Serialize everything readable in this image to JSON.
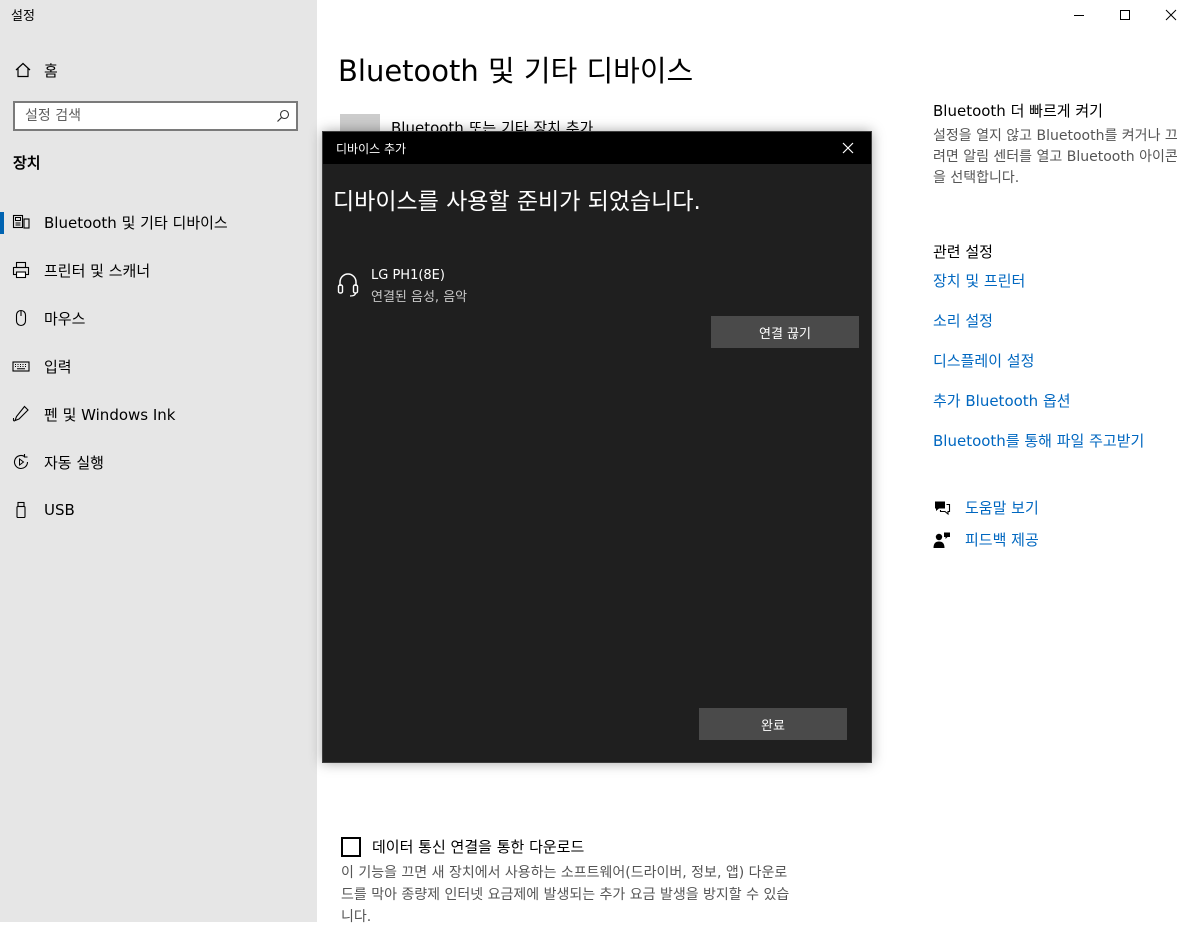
{
  "app": {
    "title": "설정"
  },
  "window_controls": {
    "minimize": "minimize-icon",
    "maximize": "maximize-icon",
    "close": "close-icon"
  },
  "sidebar": {
    "home_label": "홈",
    "search": {
      "placeholder": "설정 검색",
      "value": ""
    },
    "section_title": "장치",
    "items": [
      {
        "label": "Bluetooth 및 기타 디바이스",
        "icon": "bluetooth-device-icon",
        "selected": true
      },
      {
        "label": "프린터 및 스캐너",
        "icon": "printer-icon",
        "selected": false
      },
      {
        "label": "마우스",
        "icon": "mouse-icon",
        "selected": false
      },
      {
        "label": "입력",
        "icon": "keyboard-icon",
        "selected": false
      },
      {
        "label": "펜 및 Windows Ink",
        "icon": "pen-icon",
        "selected": false
      },
      {
        "label": "자동 실행",
        "icon": "autoplay-icon",
        "selected": false
      },
      {
        "label": "USB",
        "icon": "usb-icon",
        "selected": false
      }
    ]
  },
  "main": {
    "title": "Bluetooth 및 기타 디바이스",
    "add_device_label": "Bluetooth 또는 기타 장치 추가",
    "metered": {
      "checkbox_label": "데이터 통신 연결을 통한 다운로드",
      "checked": false,
      "description": "이 기능을 끄면 새 장치에서 사용하는 소프트웨어(드라이버, 정보, 앱) 다운로드를 막아 종량제 인터넷 요금제에 발생되는 추가 요금 발생을 방지할 수 있습니다."
    }
  },
  "right_panel": {
    "quick_heading": "Bluetooth 더 빠르게 켜기",
    "quick_text": "설정을 열지 않고 Bluetooth를 켜거나 끄려면 알림 센터를 열고 Bluetooth 아이콘을 선택합니다.",
    "related_heading": "관련 설정",
    "links": [
      "장치 및 프린터",
      "소리 설정",
      "디스플레이 설정",
      "추가 Bluetooth 옵션",
      "Bluetooth를 통해 파일 주고받기"
    ],
    "help_label": "도움말 보기",
    "feedback_label": "피드백 제공"
  },
  "dialog": {
    "title": "디바이스 추가",
    "heading": "디바이스를 사용할 준비가 되었습니다.",
    "device": {
      "name": "LG PH1(8E)",
      "status": "연결된 음성, 음악",
      "icon": "headphones-icon"
    },
    "disconnect_label": "연결 끊기",
    "done_label": "완료"
  },
  "colors": {
    "accent": "#0063b1",
    "link": "#0067c0",
    "sidebar_bg": "#e6e6e6",
    "dialog_bg": "#1f1f1f"
  }
}
